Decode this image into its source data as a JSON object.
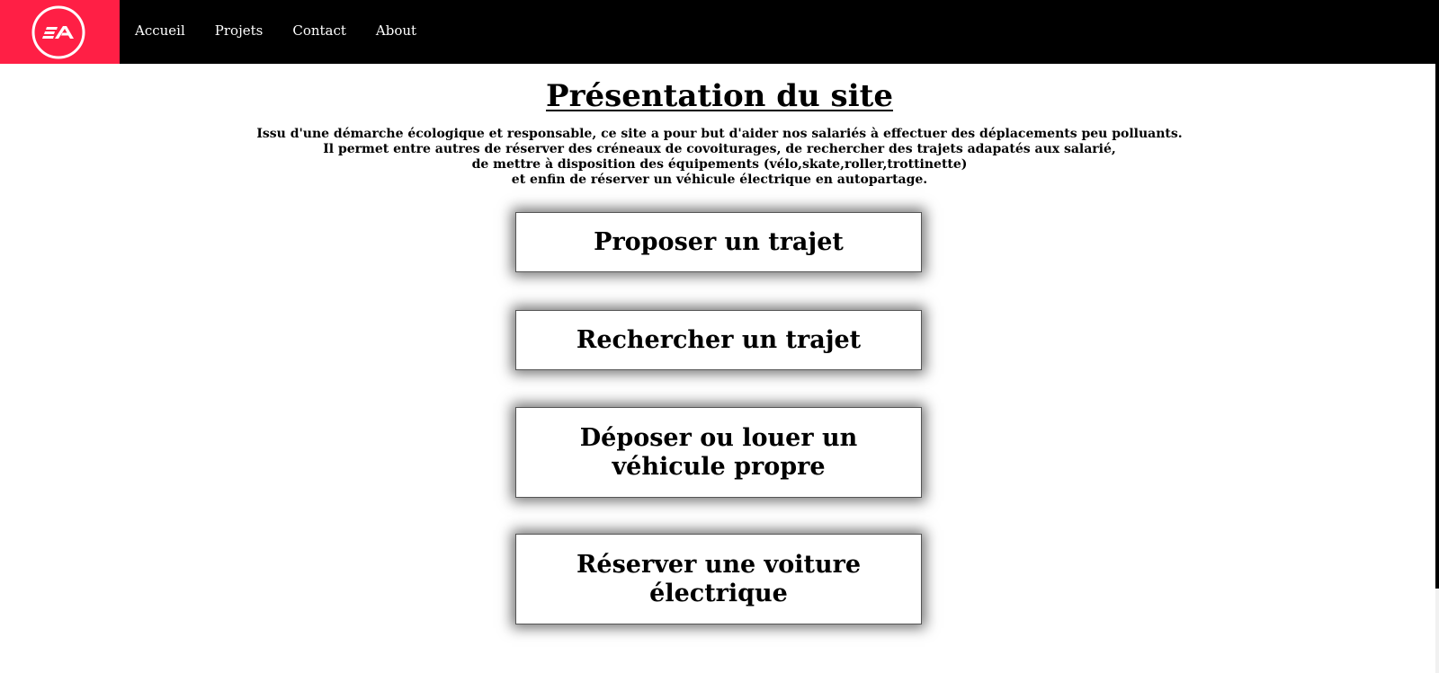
{
  "header": {
    "logo_text": "EA",
    "nav": [
      {
        "label": "Accueil"
      },
      {
        "label": "Projets"
      },
      {
        "label": "Contact"
      },
      {
        "label": "About"
      }
    ]
  },
  "main": {
    "title": "Présentation du site",
    "intro_lines": [
      "Issu d'une démarche écologique et responsable, ce site a pour but d'aider nos salariés à effectuer des déplacements peu polluants.",
      "Il permet entre autres de réserver des créneaux de covoiturages, de rechercher des trajets adapatés aux salarié,",
      "de mettre à disposition des équipements (vélo,skate,roller,trottinette)",
      "et enfin de réserver un véhicule électrique en autopartage."
    ],
    "buttons": [
      {
        "label": "Proposer un trajet"
      },
      {
        "label": "Rechercher un trajet"
      },
      {
        "label": "Déposer ou louer un véhicule propre"
      },
      {
        "label": "Réserver une voiture électrique"
      }
    ]
  },
  "colors": {
    "navbar_bg": "#000000",
    "logo_bg": "#ff1f45",
    "nav_text": "#ffffff"
  },
  "icons": {
    "logo": "ea-logo-icon"
  }
}
